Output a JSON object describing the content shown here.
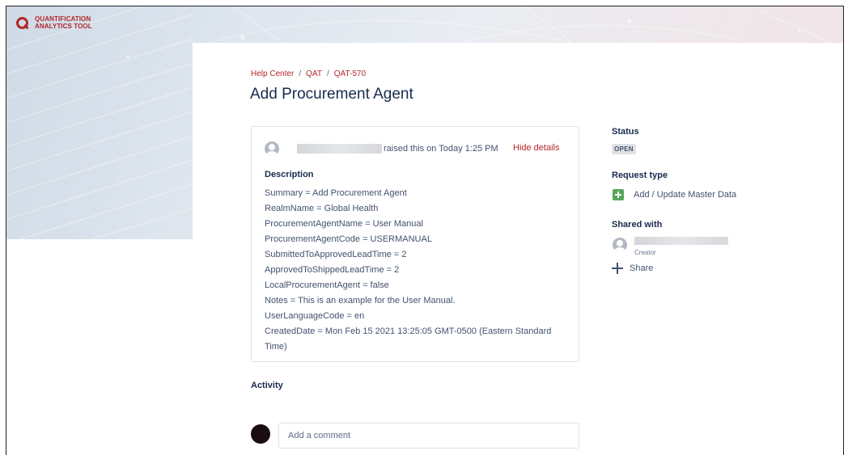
{
  "brand": {
    "line1": "QUANTIFICATION",
    "line2": "ANALYTICS TOOL",
    "color": "#b3262a"
  },
  "breadcrumb": [
    "Help Center",
    "QAT",
    "QAT-570"
  ],
  "breadcrumb_separator": "/",
  "title": "Add Procurement Agent",
  "request": {
    "raised_text": "raised this on Today 1:25 PM",
    "hide_details_label": "Hide details",
    "description_heading": "Description",
    "description_lines": [
      "Summary = Add Procurement Agent",
      "RealmName = Global Health",
      "ProcurementAgentName = User Manual",
      "ProcurementAgentCode = USERMANUAL",
      "SubmittedToApprovedLeadTime = 2",
      "ApprovedToShippedLeadTime = 2",
      "LocalProcurementAgent = false",
      "Notes = This is an example for the User Manual.",
      "UserLanguageCode = en",
      "CreatedDate = Mon Feb 15 2021 13:25:05 GMT-0500 (Eastern Standard",
      "Time)"
    ]
  },
  "activity": {
    "heading": "Activity",
    "comment_placeholder": "Add a comment"
  },
  "sidebar": {
    "status_label": "Status",
    "status_value": "OPEN",
    "request_type_label": "Request type",
    "request_type_value": "Add / Update Master Data",
    "request_type_icon": "plus-square-icon",
    "request_type_icon_color": "#57a55a",
    "shared_with_label": "Shared with",
    "creator_label": "Creator",
    "share_label": "Share"
  }
}
